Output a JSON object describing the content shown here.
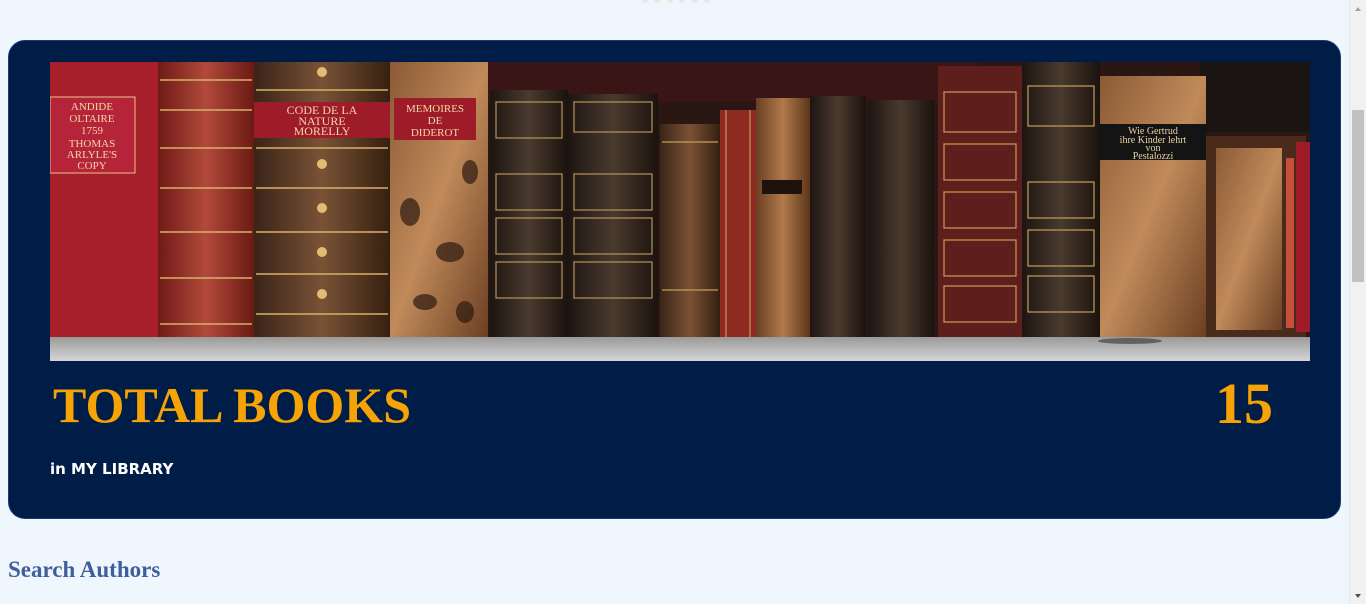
{
  "stats": {
    "label": "TOTAL BOOKS",
    "value": "15",
    "sublabel": "in MY LIBRARY"
  },
  "banner": {
    "spine_texts": {
      "candide": [
        "ANDIDE",
        "OLTAIRE",
        "1759",
        "THOMAS",
        "ARLYLE'S",
        "COPY"
      ],
      "code": [
        "CODE DE LA",
        "NATURE",
        "MORELLY"
      ],
      "memoires": [
        "MEMOIRES",
        "DE",
        "DIDEROT"
      ],
      "pestalozzi": [
        "Wie Gertrud",
        "ihre Kinder lehrt",
        "von",
        "Pestalozzi"
      ]
    }
  },
  "search": {
    "heading": "Search Authors"
  },
  "colors": {
    "page_bg": "#eff6fd",
    "card_bg": "#001d48",
    "accent": "#f5a305",
    "heading": "#3e5f9c"
  },
  "icons": {
    "scroll_up": "triangle-up",
    "scroll_down": "triangle-down"
  }
}
